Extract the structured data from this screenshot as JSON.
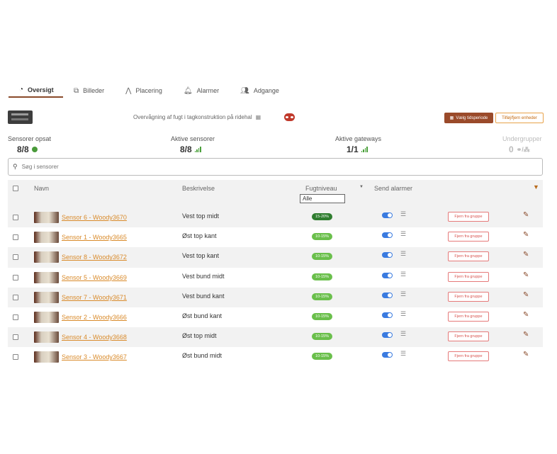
{
  "tabs": [
    {
      "label": "Oversigt",
      "icon": "gauge-icon"
    },
    {
      "label": "Billeder",
      "icon": "images-icon"
    },
    {
      "label": "Placering",
      "icon": "compass-icon"
    },
    {
      "label": "Alarmer",
      "icon": "bell-icon"
    },
    {
      "label": "Adgange",
      "icon": "users-icon"
    }
  ],
  "header": {
    "subtitle": "Overvågning af fugt i tagkonstruktion på ridehal",
    "period_button": "Vælg tidsperiode",
    "add_button": "Tilføj/fjern enheder"
  },
  "stats": {
    "sensors_label": "Sensorer opsat",
    "sensors_value": "8/8",
    "active_sensors_label": "Aktive sensorer",
    "active_sensors_value": "8/8",
    "gateways_label": "Aktive gateways",
    "gateways_value": "1/1",
    "subgroups_label": "Undergrupper",
    "subgroups_value": "0"
  },
  "search": {
    "placeholder": "Søg i sensorer"
  },
  "table": {
    "columns": {
      "name": "Navn",
      "description": "Beskrivelse",
      "moisture": "Fugtniveau",
      "alarms": "Send alarmer"
    },
    "moisture_filter": "Alle",
    "remove_label": "Fjern fra gruppe",
    "rows": [
      {
        "name": "Sensor 6 - Woody3670",
        "description": "Vest top midt",
        "moisture": "15-20%",
        "level": "dark"
      },
      {
        "name": "Sensor 1 - Woody3665",
        "description": "Øst top kant",
        "moisture": "10-15%",
        "level": "light"
      },
      {
        "name": "Sensor 8 - Woody3672",
        "description": "Vest top kant",
        "moisture": "10-15%",
        "level": "light"
      },
      {
        "name": "Sensor 5 - Woody3669",
        "description": "Vest bund midt",
        "moisture": "10-15%",
        "level": "light"
      },
      {
        "name": "Sensor 7 - Woody3671",
        "description": "Vest bund kant",
        "moisture": "10-15%",
        "level": "light"
      },
      {
        "name": "Sensor 2 - Woody3666",
        "description": "Øst bund kant",
        "moisture": "10-15%",
        "level": "light"
      },
      {
        "name": "Sensor 4 - Woody3668",
        "description": "Øst top midt",
        "moisture": "10-15%",
        "level": "light"
      },
      {
        "name": "Sensor 3 - Woody3667",
        "description": "Øst bund midt",
        "moisture": "10-15%",
        "level": "light"
      }
    ]
  },
  "colors": {
    "accent": "#9a4a2a",
    "link": "#d98a2a",
    "toggle": "#3a7be0",
    "pill_dark": "#2f7d2f",
    "pill_light": "#6abf4b"
  }
}
